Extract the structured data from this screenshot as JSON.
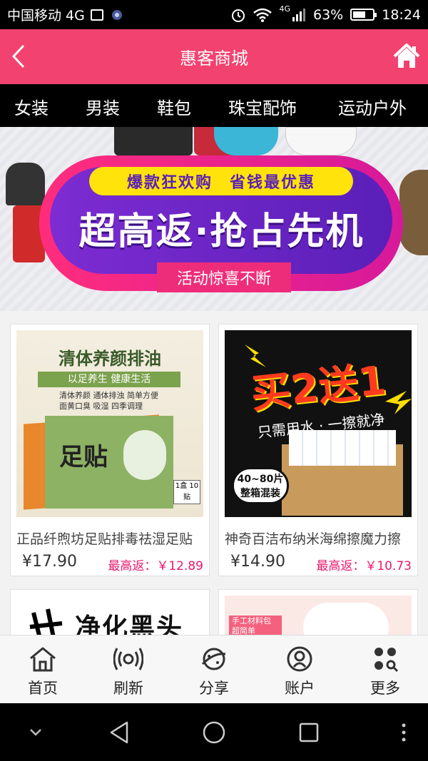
{
  "status_bar": {
    "carrier": "中国移动 4G",
    "network": "4G",
    "battery": "63%",
    "time": "18:24",
    "battery_level": 0.63
  },
  "header": {
    "title": "惠客商城"
  },
  "categories": [
    "女装",
    "男装",
    "鞋包",
    "珠宝配饰",
    "运动户外"
  ],
  "banner": {
    "tagline": "爆款狂欢购　省钱最优惠",
    "headline": "超高返·抢占先机",
    "subline": "活动惊喜不断"
  },
  "products": [
    {
      "name": "正品纤煦坊足贴排毒祛湿足贴",
      "price": "¥17.90",
      "rebate": "最高返：￥12.89",
      "image_text": {
        "title": "清体养颜排油",
        "slogan": "以足养生 健康生活",
        "features": [
          "清体养颜",
          "通体排浊",
          "简单方便",
          "面黄口臭",
          "吸湿",
          "四季调理"
        ],
        "box_label": "足贴",
        "count": "1盒 10贴"
      }
    },
    {
      "name": "神奇百洁布纳米海绵擦魔力擦",
      "price": "¥14.90",
      "rebate": "最高返：￥10.73",
      "image_text": {
        "headline": "买2送1",
        "slogan": "只需用水 · 一擦就净",
        "badge_line1": "40~80片",
        "badge_line2": "整箱混装"
      }
    },
    {
      "image_text": {
        "headline": "净化黑头"
      }
    },
    {
      "image_text": {
        "headline": "手工材料包 超简单"
      }
    }
  ],
  "bottom_nav": [
    {
      "label": "首页",
      "icon": "home-icon"
    },
    {
      "label": "刷新",
      "icon": "refresh-icon"
    },
    {
      "label": "分享",
      "icon": "share-icon"
    },
    {
      "label": "账户",
      "icon": "account-icon"
    },
    {
      "label": "更多",
      "icon": "more-icon"
    }
  ],
  "colors": {
    "brand": "#f2426f",
    "rebate": "#e8196f",
    "tab_bar": "#000000"
  }
}
